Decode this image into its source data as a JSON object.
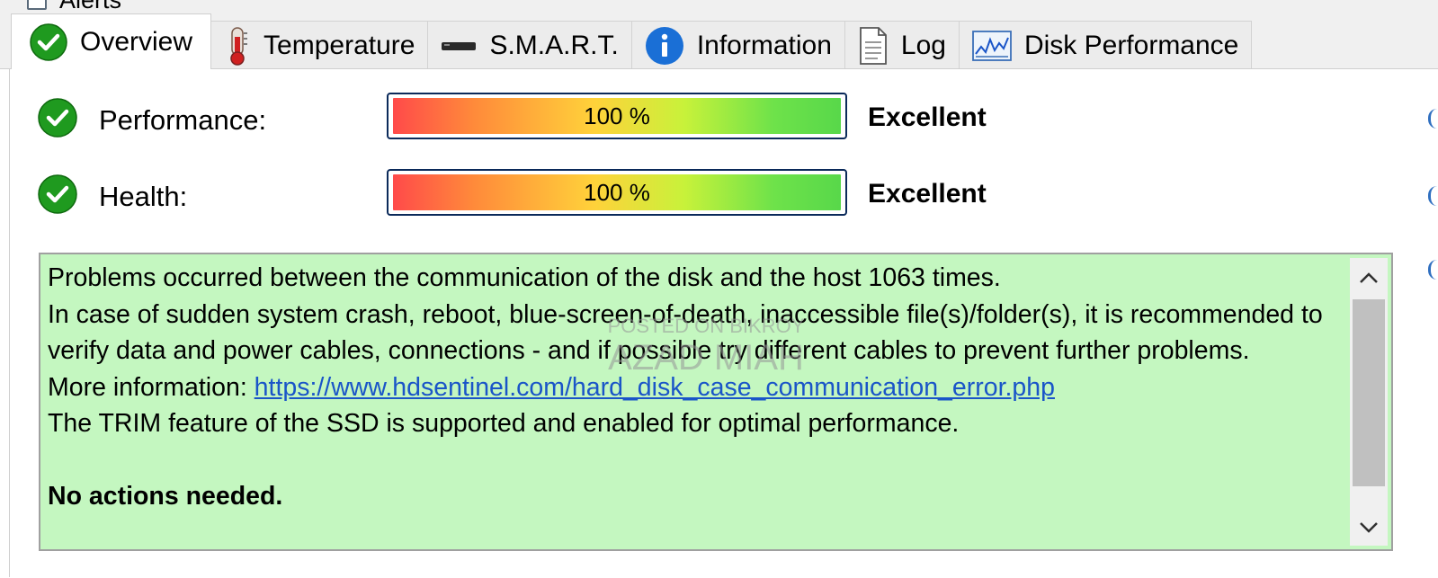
{
  "top": {
    "alerts_label": "Alerts"
  },
  "tabs": [
    {
      "label": "Overview",
      "icon": "check-circle-icon",
      "active": true
    },
    {
      "label": "Temperature",
      "icon": "thermometer-icon",
      "active": false
    },
    {
      "label": "S.M.A.R.T.",
      "icon": "drive-icon",
      "active": false
    },
    {
      "label": "Information",
      "icon": "info-icon",
      "active": false
    },
    {
      "label": "Log",
      "icon": "document-icon",
      "active": false
    },
    {
      "label": "Disk Performance",
      "icon": "chart-icon",
      "active": false
    }
  ],
  "metrics": [
    {
      "label": "Performance:",
      "value_text": "100 %",
      "value": 100,
      "rating": "Excellent",
      "icon": "check-circle-icon"
    },
    {
      "label": "Health:",
      "value_text": "100 %",
      "value": 100,
      "rating": "Excellent",
      "icon": "check-circle-icon"
    }
  ],
  "message": {
    "line1": "Problems occurred between the communication of the disk and the host 1063 times.",
    "line2": "In case of sudden system crash, reboot, blue-screen-of-death, inaccessible file(s)/folder(s), it is recommended to verify data and power cables, connections - and if possible try different cables to prevent further problems.",
    "more_info_prefix": "More information: ",
    "link": "https://www.hdsentinel.com/hard_disk_case_communication_error.php",
    "line4": "The TRIM feature of the SSD is supported and enabled for optimal performance.",
    "conclusion": "No actions needed."
  },
  "watermark": {
    "line1": "POSTED ON BIKROY",
    "line2": "AZAD MIAH"
  },
  "colors": {
    "panel_bg": "#ffffff",
    "message_bg": "#c4f7c0",
    "check_green": "#1f9a1f",
    "link": "#1a55c8",
    "bar_border": "#0b2a5a"
  }
}
